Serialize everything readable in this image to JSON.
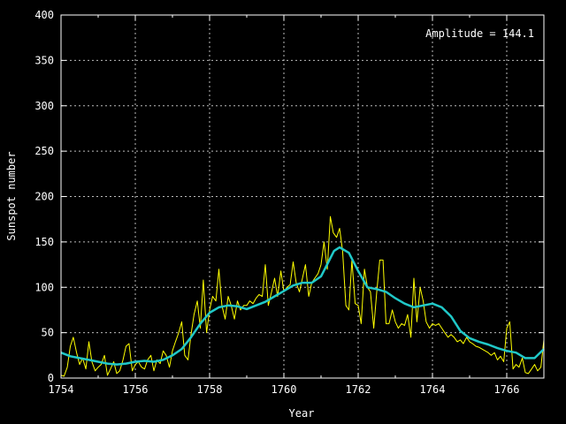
{
  "chart_data": {
    "type": "line",
    "title": "",
    "xlabel": "Year",
    "ylabel": "Sunspot number",
    "xlim": [
      1754,
      1767
    ],
    "ylim": [
      0,
      400
    ],
    "x_ticks": [
      "1754",
      "1756",
      "1758",
      "1760",
      "1762",
      "1764",
      "1766"
    ],
    "y_ticks": [
      "0",
      "50",
      "100",
      "150",
      "200",
      "250",
      "300",
      "350",
      "400"
    ],
    "grid": true,
    "annotation": "Amplitude = 144.1",
    "colors": {
      "background": "#000000",
      "axes": "#ffffff",
      "grid": "#bbbbbb",
      "monthly": "#ffff00",
      "smoothed": "#20c8c8"
    },
    "series": [
      {
        "x": [
          1754.0,
          1754.08,
          1754.17,
          1754.25,
          1754.33,
          1754.42,
          1754.5,
          1754.58,
          1754.67,
          1754.75,
          1754.83,
          1754.92,
          1755.0,
          1755.08,
          1755.17,
          1755.25,
          1755.33,
          1755.42,
          1755.5,
          1755.58,
          1755.67,
          1755.75,
          1755.83,
          1755.92,
          1756.0,
          1756.08,
          1756.17,
          1756.25,
          1756.33,
          1756.42,
          1756.5,
          1756.58,
          1756.67,
          1756.75,
          1756.83,
          1756.92,
          1757.0,
          1757.08,
          1757.17,
          1757.25,
          1757.33,
          1757.42,
          1757.5,
          1757.58,
          1757.67,
          1757.75,
          1757.83,
          1757.92,
          1758.0,
          1758.08,
          1758.17,
          1758.25,
          1758.33,
          1758.42,
          1758.5,
          1758.58,
          1758.67,
          1758.75,
          1758.83,
          1758.92,
          1759.0,
          1759.08,
          1759.17,
          1759.25,
          1759.33,
          1759.42,
          1759.5,
          1759.58,
          1759.67,
          1759.75,
          1759.83,
          1759.92,
          1760.0,
          1760.08,
          1760.17,
          1760.25,
          1760.33,
          1760.42,
          1760.5,
          1760.58,
          1760.67,
          1760.75,
          1760.83,
          1760.92,
          1761.0,
          1761.08,
          1761.17,
          1761.25,
          1761.33,
          1761.42,
          1761.5,
          1761.58,
          1761.67,
          1761.75,
          1761.83,
          1761.92,
          1762.0,
          1762.08,
          1762.17,
          1762.25,
          1762.33,
          1762.42,
          1762.5,
          1762.58,
          1762.67,
          1762.75,
          1762.83,
          1762.92,
          1763.0,
          1763.08,
          1763.17,
          1763.25,
          1763.33,
          1763.42,
          1763.5,
          1763.58,
          1763.67,
          1763.75,
          1763.83,
          1763.92,
          1764.0,
          1764.08,
          1764.17,
          1764.25,
          1764.33,
          1764.42,
          1764.5,
          1764.58,
          1764.67,
          1764.75,
          1764.83,
          1764.92,
          1765.0,
          1765.08,
          1765.17,
          1765.25,
          1765.33,
          1765.42,
          1765.5,
          1765.58,
          1765.67,
          1765.75,
          1765.83,
          1765.92,
          1766.0,
          1766.08,
          1766.17,
          1766.25,
          1766.33,
          1766.42,
          1766.5,
          1766.58,
          1766.67,
          1766.75,
          1766.83,
          1766.92,
          1767.0
        ],
        "y": [
          3,
          2,
          12,
          35,
          45,
          28,
          15,
          22,
          10,
          40,
          18,
          8,
          12,
          15,
          25,
          3,
          10,
          18,
          5,
          8,
          20,
          35,
          38,
          8,
          15,
          18,
          12,
          10,
          20,
          25,
          8,
          20,
          16,
          30,
          25,
          12,
          30,
          40,
          50,
          62,
          25,
          20,
          48,
          70,
          85,
          55,
          108,
          50,
          75,
          90,
          85,
          120,
          80,
          65,
          90,
          80,
          65,
          85,
          75,
          80,
          80,
          85,
          82,
          88,
          92,
          90,
          125,
          80,
          95,
          110,
          90,
          118,
          95,
          100,
          103,
          128,
          105,
          95,
          110,
          125,
          90,
          105,
          110,
          115,
          125,
          150,
          120,
          178,
          160,
          155,
          165,
          140,
          80,
          75,
          130,
          82,
          80,
          60,
          120,
          100,
          95,
          55,
          95,
          130,
          130,
          60,
          60,
          75,
          62,
          55,
          60,
          58,
          70,
          45,
          110,
          62,
          100,
          85,
          62,
          55,
          60,
          58,
          60,
          55,
          50,
          45,
          48,
          45,
          40,
          42,
          38,
          45,
          40,
          38,
          35,
          34,
          32,
          30,
          28,
          25,
          28,
          20,
          24,
          18,
          55,
          62,
          10,
          15,
          12,
          22,
          6,
          5,
          10,
          15,
          8,
          12,
          42
        ]
      },
      {
        "x": [
          1754.0,
          1754.25,
          1754.5,
          1754.75,
          1755.0,
          1755.25,
          1755.5,
          1755.75,
          1756.0,
          1756.25,
          1756.5,
          1756.75,
          1757.0,
          1757.25,
          1757.5,
          1757.75,
          1758.0,
          1758.25,
          1758.5,
          1758.75,
          1759.0,
          1759.25,
          1759.5,
          1759.75,
          1760.0,
          1760.25,
          1760.5,
          1760.75,
          1761.0,
          1761.2,
          1761.35,
          1761.5,
          1761.75,
          1762.0,
          1762.25,
          1762.5,
          1762.75,
          1763.0,
          1763.25,
          1763.5,
          1763.75,
          1764.0,
          1764.25,
          1764.5,
          1764.75,
          1765.0,
          1765.25,
          1765.5,
          1765.75,
          1766.0,
          1766.25,
          1766.5,
          1766.75,
          1767.0
        ],
        "y": [
          28,
          24,
          22,
          20,
          18,
          16,
          15,
          16,
          18,
          19,
          18,
          20,
          25,
          32,
          45,
          60,
          72,
          78,
          80,
          79,
          76,
          80,
          84,
          90,
          96,
          102,
          105,
          105,
          112,
          128,
          140,
          144,
          138,
          118,
          100,
          98,
          95,
          88,
          82,
          78,
          80,
          82,
          78,
          68,
          52,
          44,
          40,
          37,
          33,
          30,
          28,
          22,
          22,
          32
        ]
      }
    ]
  }
}
